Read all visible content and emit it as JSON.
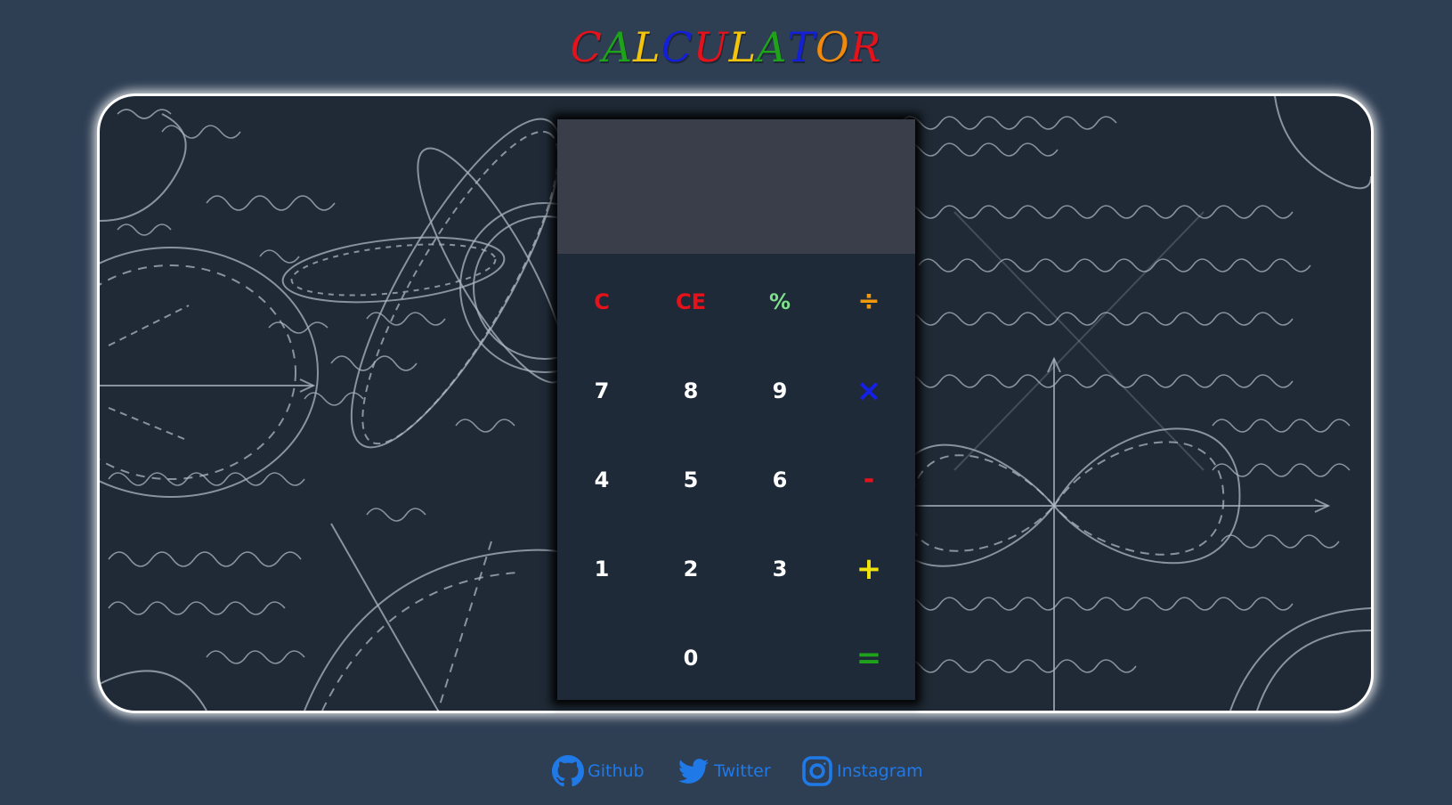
{
  "title": {
    "letters": [
      {
        "ch": "C",
        "color": "#e3121b"
      },
      {
        "ch": "A",
        "color": "#1fa31a"
      },
      {
        "ch": "L",
        "color": "#f2c40c"
      },
      {
        "ch": "C",
        "color": "#1420d8"
      },
      {
        "ch": "U",
        "color": "#e3121b"
      },
      {
        "ch": "L",
        "color": "#f2c40c"
      },
      {
        "ch": "A",
        "color": "#1fa31a"
      },
      {
        "ch": "T",
        "color": "#1420d8"
      },
      {
        "ch": "O",
        "color": "#f08a0c"
      },
      {
        "ch": "R",
        "color": "#e3121b"
      }
    ]
  },
  "calculator": {
    "display_value": "",
    "keys": {
      "clear": {
        "label": "C",
        "color": "#e3121b"
      },
      "clear_entry": {
        "label": "CE",
        "color": "#e3121b"
      },
      "percent": {
        "label": "%",
        "color": "#7ee08a"
      },
      "divide": {
        "label": "÷",
        "color": "#f29a0c"
      },
      "seven": {
        "label": "7"
      },
      "eight": {
        "label": "8"
      },
      "nine": {
        "label": "9"
      },
      "multiply": {
        "label": "×",
        "color": "#1420e8"
      },
      "four": {
        "label": "4"
      },
      "five": {
        "label": "5"
      },
      "six": {
        "label": "6"
      },
      "subtract": {
        "label": "-",
        "color": "#e3121b"
      },
      "one": {
        "label": "1"
      },
      "two": {
        "label": "2"
      },
      "three": {
        "label": "3"
      },
      "add": {
        "label": "+",
        "color": "#f2e20c"
      },
      "zero": {
        "label": "0"
      },
      "equals": {
        "label": "=",
        "color": "#1fa31a"
      }
    }
  },
  "footer": {
    "github": {
      "label": "Github",
      "icon": "github-icon"
    },
    "twitter": {
      "label": "Twitter",
      "icon": "twitter-icon"
    },
    "instagram": {
      "label": "Instagram",
      "icon": "instagram-icon"
    },
    "link_color": "#1f7ae8"
  },
  "colors": {
    "page_background": "#2e3e53",
    "display_background": "#3a3e4b",
    "keypad_background": "#1e2a38",
    "chalkboard": "#1f2a36"
  }
}
